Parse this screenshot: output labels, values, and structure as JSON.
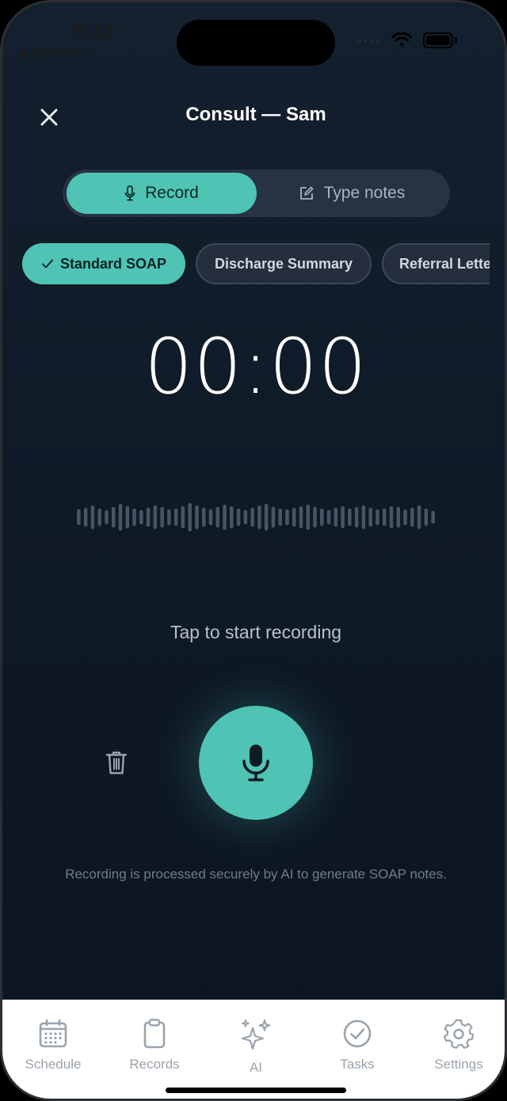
{
  "status": {
    "time": "9:17",
    "back_label": "ApexVet"
  },
  "header": {
    "title": "Consult — Sam"
  },
  "mode_toggle": {
    "record_label": "Record",
    "type_label": "Type notes",
    "selected": "Record"
  },
  "templates": {
    "items": [
      {
        "label": "Standard SOAP",
        "selected": true
      },
      {
        "label": "Discharge Summary",
        "selected": false
      },
      {
        "label": "Referral Letter",
        "selected": false
      }
    ]
  },
  "timer": {
    "minutes": "00",
    "separator": ":",
    "seconds": "00"
  },
  "prompt": {
    "text": "Tap to start recording"
  },
  "footnote": {
    "text": "Recording is processed securely by AI to generate SOAP notes."
  },
  "tabbar": {
    "items": [
      {
        "label": "Schedule",
        "icon": "calendar-icon"
      },
      {
        "label": "Records",
        "icon": "clipboard-icon"
      },
      {
        "label": "AI",
        "icon": "sparkles-icon"
      },
      {
        "label": "Tasks",
        "icon": "check-circle-icon"
      },
      {
        "label": "Settings",
        "icon": "gear-icon"
      }
    ]
  },
  "colors": {
    "accent": "#4fc3b4",
    "background": "#0f1a27",
    "tab_inactive": "#9aa3ad"
  }
}
